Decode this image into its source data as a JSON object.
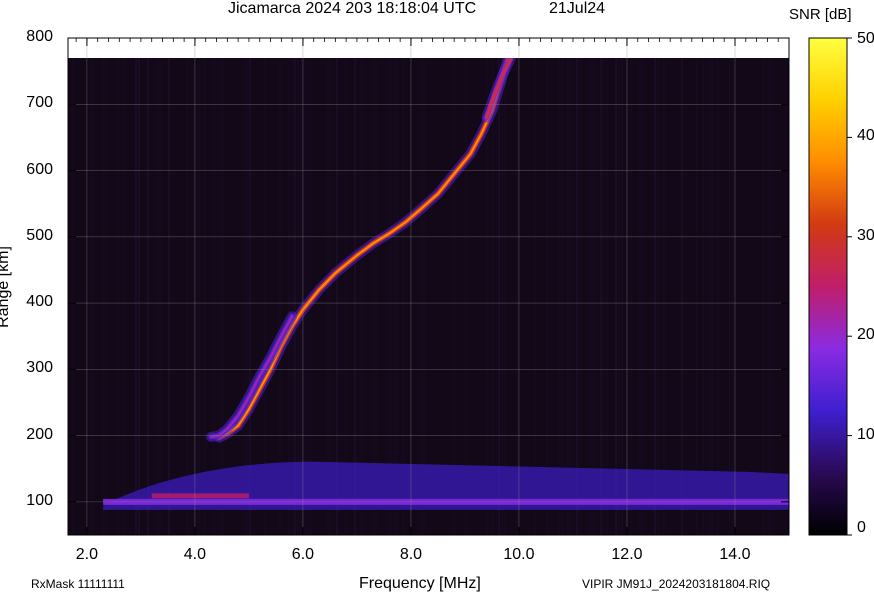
{
  "header": {
    "title": "Jicamarca 2024 203 18:18:04 UTC",
    "date": "21Jul24"
  },
  "footer": {
    "rxmask": "RxMask 11111111",
    "file_info": "VIPIR  JM91J_2024203181804.RIQ"
  },
  "chart_data": {
    "type": "heatmap",
    "title": "Jicamarca 2024 203 18:18:04 UTC",
    "xlabel": "Frequency [MHz]",
    "ylabel": "Range [km]",
    "xlim": [
      1.65,
      15.0
    ],
    "ylim": [
      50,
      800
    ],
    "x_ticks": [
      "2.0",
      "4.0",
      "6.0",
      "8.0",
      "10.0",
      "12.0",
      "14.0"
    ],
    "x_tick_values": [
      2,
      4,
      6,
      8,
      10,
      12,
      14
    ],
    "y_ticks": [
      "100",
      "200",
      "300",
      "400",
      "500",
      "600",
      "700",
      "800"
    ],
    "y_tick_values": [
      100,
      200,
      300,
      400,
      500,
      600,
      700,
      800
    ],
    "colorbar": {
      "label": "SNR [dB]",
      "range": [
        0,
        50
      ],
      "ticks": [
        "0",
        "10",
        "20",
        "30",
        "40",
        "50"
      ],
      "tick_values": [
        0,
        10,
        20,
        30,
        40,
        50
      ],
      "colormap": [
        "#000000",
        "#2a0a55",
        "#3f1fd0",
        "#8a2be2",
        "#c01e6a",
        "#d23a12",
        "#ff8c00",
        "#ffd000",
        "#ffff40"
      ]
    },
    "grid": true,
    "data_ceiling_km": 770,
    "traces": [
      {
        "name": "",
        "points": [
          [
            4.45,
            197
          ],
          [
            4.6,
            203
          ],
          [
            4.8,
            215
          ],
          [
            5.0,
            240
          ],
          [
            5.2,
            270
          ],
          [
            5.4,
            300
          ],
          [
            5.6,
            335
          ],
          [
            5.8,
            365
          ],
          [
            6.0,
            390
          ],
          [
            6.3,
            420
          ],
          [
            6.6,
            445
          ],
          [
            7.0,
            472
          ],
          [
            7.3,
            490
          ],
          [
            7.6,
            505
          ],
          [
            7.9,
            522
          ],
          [
            8.2,
            543
          ],
          [
            8.5,
            565
          ],
          [
            8.8,
            595
          ],
          [
            9.1,
            625
          ],
          [
            9.3,
            655
          ],
          [
            9.5,
            690
          ],
          [
            9.65,
            730
          ],
          [
            9.8,
            770
          ]
        ],
        "peak_snr_db": 38
      },
      {
        "name": "",
        "points": [
          [
            4.3,
            198
          ],
          [
            4.45,
            200
          ],
          [
            4.6,
            210
          ],
          [
            4.8,
            230
          ],
          [
            5.0,
            258
          ],
          [
            5.2,
            290
          ],
          [
            5.4,
            318
          ],
          [
            5.6,
            350
          ],
          [
            5.8,
            380
          ]
        ],
        "peak_snr_db": 22
      },
      {
        "name": "",
        "points": [
          [
            9.4,
            680
          ],
          [
            9.55,
            715
          ],
          [
            9.7,
            745
          ],
          [
            9.85,
            770
          ]
        ],
        "peak_snr_db": 30
      }
    ],
    "e_layer": {
      "range_km": 100,
      "x_from": 2.3,
      "x_to": 15.0,
      "peak_snr_db": 25
    }
  }
}
